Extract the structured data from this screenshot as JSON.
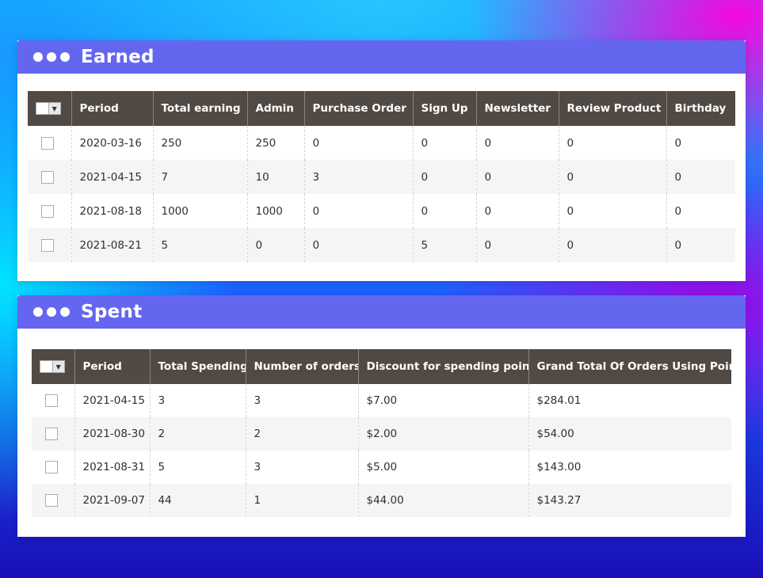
{
  "earned": {
    "title": "Earned",
    "columns": [
      "Period",
      "Total earning",
      "Admin",
      "Purchase Order",
      "Sign Up",
      "Newsletter",
      "Review Product",
      "Birthday"
    ],
    "rows": [
      [
        "2020-03-16",
        "250",
        "250",
        "0",
        "0",
        "0",
        "0",
        "0"
      ],
      [
        "2021-04-15",
        "7",
        "10",
        "3",
        "0",
        "0",
        "0",
        "0"
      ],
      [
        "2021-08-18",
        "1000",
        "1000",
        "0",
        "0",
        "0",
        "0",
        "0"
      ],
      [
        "2021-08-21",
        "5",
        "0",
        "0",
        "5",
        "0",
        "0",
        "0"
      ]
    ]
  },
  "spent": {
    "title": "Spent",
    "columns": [
      "Period",
      "Total Spending",
      "Number of orders",
      "Discount for spending points",
      "Grand Total Of Orders Using Points"
    ],
    "rows": [
      [
        "2021-04-15",
        "3",
        "3",
        "$7.00",
        "$284.01"
      ],
      [
        "2021-08-30",
        "2",
        "2",
        "$2.00",
        "$54.00"
      ],
      [
        "2021-08-31",
        "5",
        "3",
        "$5.00",
        "$143.00"
      ],
      [
        "2021-09-07",
        "44",
        "1",
        "$44.00",
        "$143.27"
      ]
    ]
  },
  "icons": {
    "mass_select_arrow": "chevron-down-icon",
    "header_dots": "window-dots-icon"
  },
  "colors": {
    "header_bar": "#6566f0",
    "table_header": "#514943"
  }
}
